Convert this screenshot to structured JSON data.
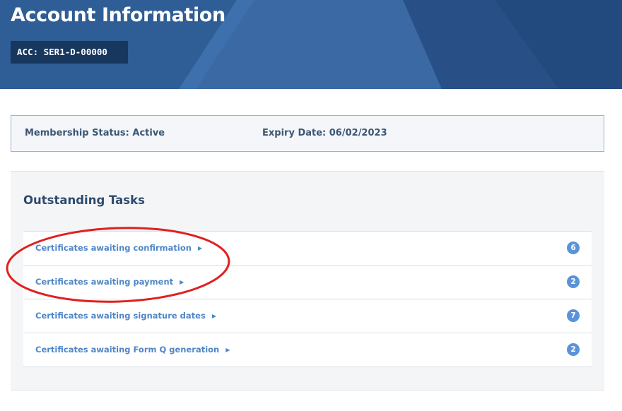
{
  "header": {
    "title": "Account Information",
    "account_badge": "ACC: SER1-D-00000"
  },
  "status": {
    "membership": "Membership Status: Active",
    "expiry": "Expiry Date: 06/02/2023"
  },
  "tasks": {
    "title": "Outstanding Tasks",
    "items": [
      {
        "label": "Certificates awaiting confirmation",
        "count": "6"
      },
      {
        "label": "Certificates awaiting payment",
        "count": "2"
      },
      {
        "label": "Certificates awaiting signature dates",
        "count": "7"
      },
      {
        "label": "Certificates awaiting Form Q generation",
        "count": "2"
      }
    ]
  },
  "colors": {
    "header_bg": "#2f5d95",
    "badge_bg": "#17375f",
    "link": "#4f86c6",
    "count_badge": "#5b93d8",
    "annotation": "#e02020"
  },
  "icons": {
    "task_arrow": "right-triangle-icon"
  }
}
